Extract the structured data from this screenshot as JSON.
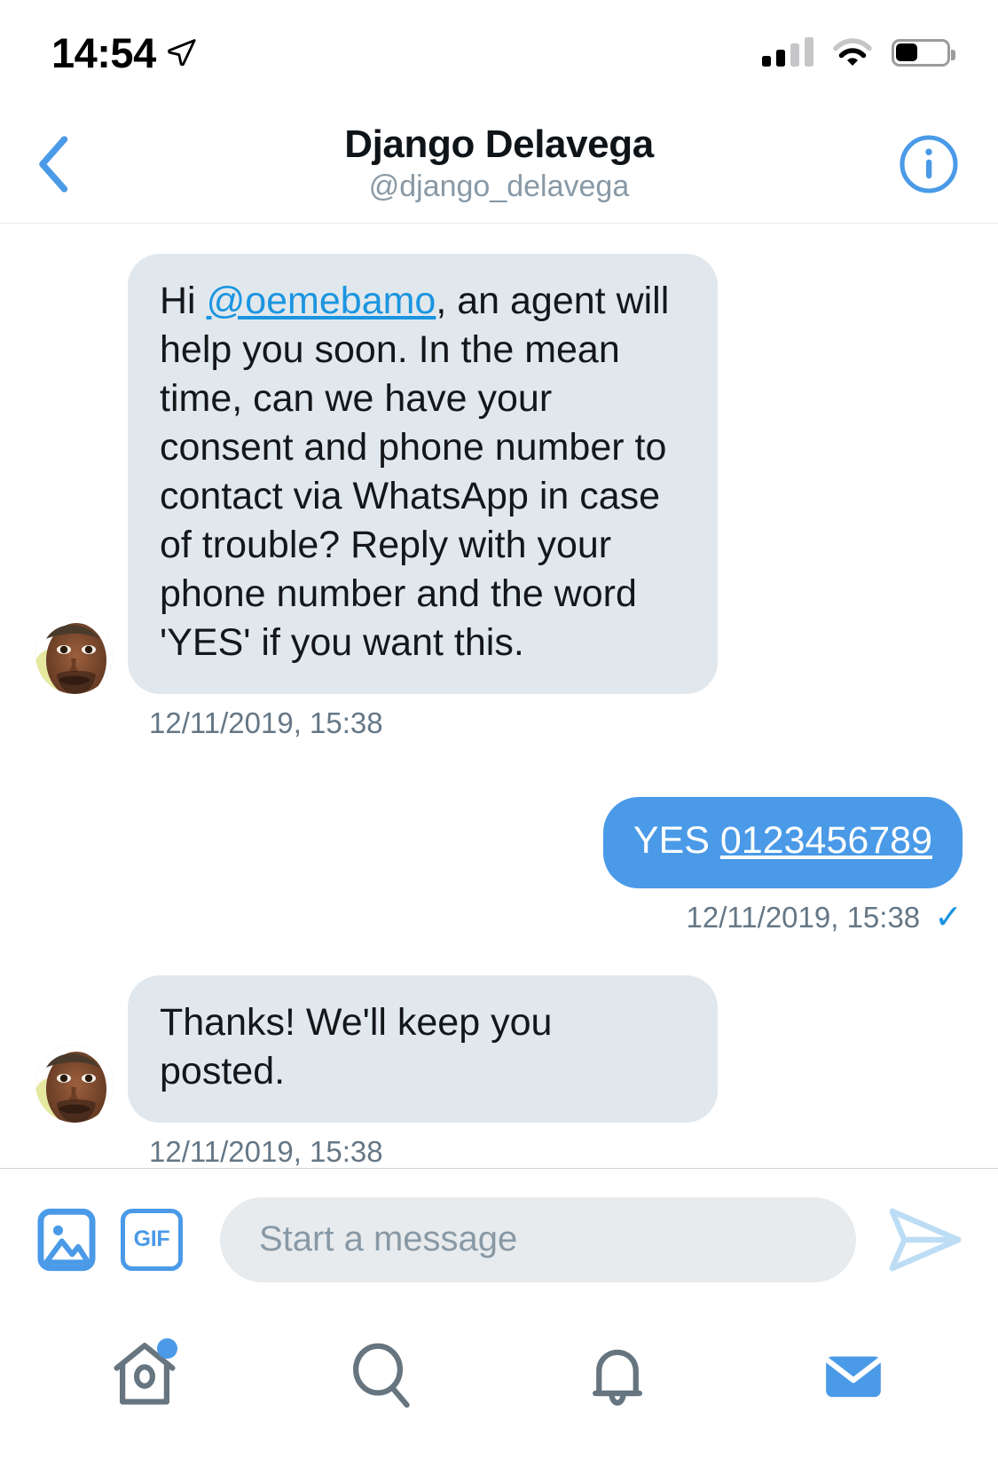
{
  "status_bar": {
    "time": "14:54",
    "location_icon": "location-arrow-icon",
    "signal_icon": "cellular-signal-icon",
    "wifi_icon": "wifi-icon",
    "battery_icon": "battery-icon"
  },
  "header": {
    "back_icon": "chevron-left-icon",
    "title": "Django Delavega",
    "handle": "@django_delavega",
    "info_icon": "info-circle-icon"
  },
  "conversation": {
    "messages": [
      {
        "direction": "incoming",
        "avatar": "contact-avatar",
        "text_before_mention": "Hi ",
        "mention": "@oemebamo",
        "text_after_mention": ", an agent will help you soon. In the mean time, can we have your consent and phone number to contact via WhatsApp in case of trouble? Reply with your phone number and the word 'YES' if you want this.",
        "timestamp": "12/11/2019, 15:38"
      },
      {
        "direction": "outgoing",
        "text_prefix": "YES ",
        "link": "0123456789",
        "timestamp": "12/11/2019, 15:38",
        "status_icon": "checkmark-icon",
        "status_glyph": "✓"
      },
      {
        "direction": "incoming",
        "avatar": "contact-avatar",
        "text": "Thanks! We'll keep you posted.",
        "timestamp": "12/11/2019, 15:38"
      }
    ]
  },
  "composer": {
    "photo_icon": "image-icon",
    "gif_icon": "gif-icon",
    "gif_label": "GIF",
    "input_placeholder": "Start a message",
    "input_value": "",
    "send_icon": "send-arrow-icon"
  },
  "tabbar": {
    "items": [
      {
        "name": "home-tab",
        "icon": "home-icon",
        "badge": true
      },
      {
        "name": "search-tab",
        "icon": "search-icon",
        "badge": false
      },
      {
        "name": "notifications-tab",
        "icon": "bell-icon",
        "badge": false
      },
      {
        "name": "messages-tab",
        "icon": "envelope-icon",
        "badge": false,
        "active": true
      }
    ]
  },
  "colors": {
    "accent_blue": "#4a9ae8",
    "link_blue": "#1b95e0",
    "incoming_bubble": "#e1e8ed",
    "outgoing_bubble": "#4a9ae8",
    "muted_text": "#657786",
    "tab_inactive": "#66757f"
  }
}
